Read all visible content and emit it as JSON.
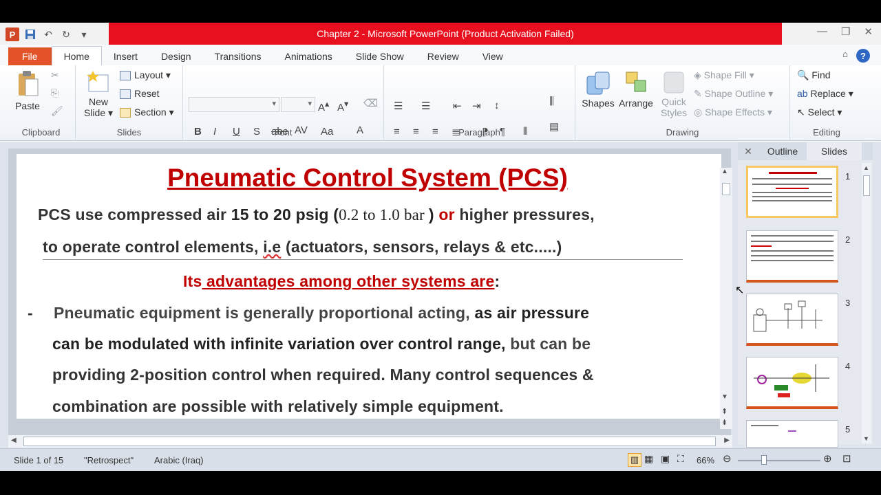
{
  "window": {
    "title": "Chapter 2  -  Microsoft PowerPoint (Product Activation Failed)"
  },
  "tabs": [
    {
      "label": "File"
    },
    {
      "label": "Home"
    },
    {
      "label": "Insert"
    },
    {
      "label": "Design"
    },
    {
      "label": "Transitions"
    },
    {
      "label": "Animations"
    },
    {
      "label": "Slide Show"
    },
    {
      "label": "Review"
    },
    {
      "label": "View"
    }
  ],
  "ribbon": {
    "clipboard": {
      "paste": "Paste",
      "label": "Clipboard"
    },
    "slides": {
      "new_slide": "New",
      "new_slide2": "Slide",
      "layout": "Layout",
      "reset": "Reset",
      "section": "Section",
      "label": "Slides"
    },
    "font": {
      "label": "Font"
    },
    "paragraph": {
      "label": "Paragraph"
    },
    "drawing": {
      "shapes": "Shapes",
      "arrange": "Arrange",
      "quick": "Quick",
      "styles": "Styles",
      "shape_fill": "Shape Fill",
      "shape_outline": "Shape Outline",
      "shape_effects": "Shape Effects",
      "label": "Drawing"
    },
    "editing": {
      "find": "Find",
      "replace": "Replace",
      "select": "Select",
      "label": "Editing"
    }
  },
  "slide": {
    "title": "Pneumatic Control System (PCS)",
    "line1_a": "PCS use compressed air ",
    "line1_b": "15 to 20 psig (",
    "line1_c": "0.2 to 1.0 bar ",
    "line1_d": ") ",
    "line1_e": "or",
    "line1_f": "  higher pressures,",
    "line2_a": "to operate  control elements, ",
    "line2_b": "i.e",
    "line2_c": "  (actuators, sensors, relays & etc.....)",
    "heading_a": "Its",
    "heading_b": "  advantages among other systems are",
    "heading_c": ":",
    "bullet_dash": "-",
    "b1": "Pneumatic equipment is generally proportional acting, ",
    "b1b": "as air pressure",
    "b2a": "can be modulated with infinite variation over control range, ",
    "b2b": "but can be",
    "b3": "providing 2-position control when required. Many control sequences &",
    "b4": "combination are possible with relatively simple equipment."
  },
  "pane": {
    "outline_tab": "Outline",
    "slides_tab": "Slides",
    "thumbs": [
      "1",
      "2",
      "3",
      "4",
      "5"
    ]
  },
  "status": {
    "slide_of": "Slide 1 of 15",
    "theme": "\"Retrospect\"",
    "language": "Arabic (Iraq)",
    "zoom": "66%"
  }
}
